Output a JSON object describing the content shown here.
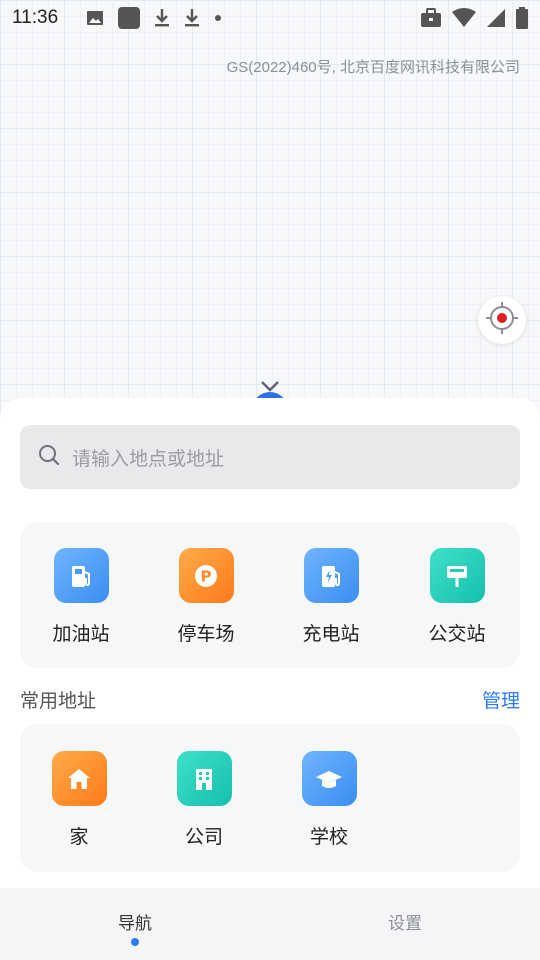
{
  "status_bar": {
    "time": "11:36",
    "left_icons": [
      "image-icon",
      "app-square-icon",
      "download-icon",
      "download-icon",
      "dot-icon"
    ],
    "right_icons": [
      "briefcase-icon",
      "wifi-icon",
      "signal-icon",
      "battery-icon"
    ]
  },
  "map": {
    "copyright": "GS(2022)460号, 北京百度网讯科技有限公司"
  },
  "search": {
    "placeholder": "请输入地点或地址"
  },
  "poi": {
    "items": [
      {
        "label": "加油站",
        "icon": "gas-station-icon",
        "color": "#4a9cf7"
      },
      {
        "label": "停车场",
        "icon": "parking-icon",
        "color": "#ff8a24"
      },
      {
        "label": "充电站",
        "icon": "charging-station-icon",
        "color": "#4a9cf7"
      },
      {
        "label": "公交站",
        "icon": "bus-stop-icon",
        "color": "#22cdb8"
      }
    ]
  },
  "favorites": {
    "title": "常用地址",
    "manage_label": "管理",
    "items": [
      {
        "label": "家",
        "icon": "home-icon",
        "color": "#ff8a24"
      },
      {
        "label": "公司",
        "icon": "office-building-icon",
        "color": "#22cdb8"
      },
      {
        "label": "学校",
        "icon": "graduation-cap-icon",
        "color": "#4a9cf7"
      }
    ]
  },
  "nav": {
    "tabs": [
      {
        "label": "导航",
        "active": true
      },
      {
        "label": "设置",
        "active": false
      }
    ]
  },
  "colors": {
    "accent": "#2b7cf6",
    "locate_dot": "#e02020"
  }
}
